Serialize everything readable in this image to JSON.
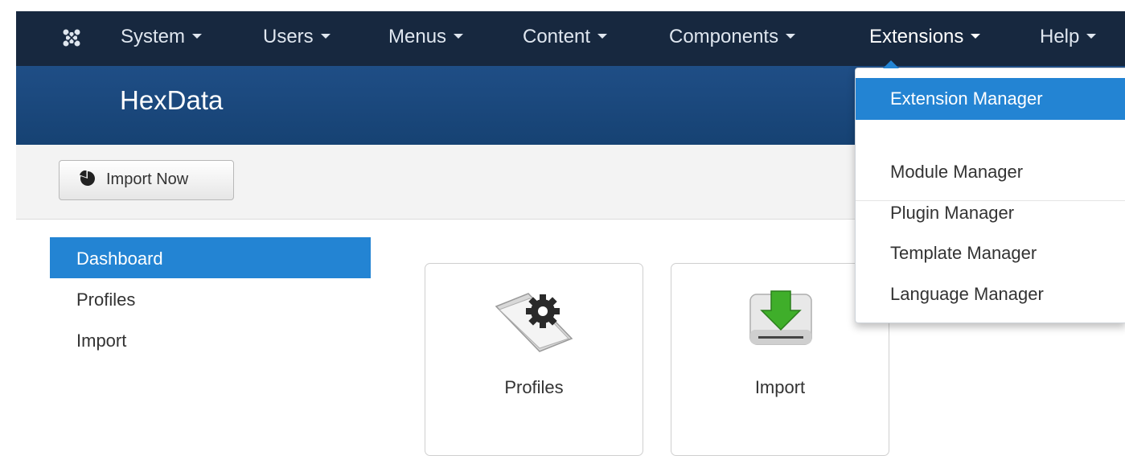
{
  "topbar": {
    "logo_icon": "joomla-logo-icon",
    "menus": [
      {
        "label": "System"
      },
      {
        "label": "Users"
      },
      {
        "label": "Menus"
      },
      {
        "label": "Content"
      },
      {
        "label": "Components"
      },
      {
        "label": "Extensions"
      },
      {
        "label": "Help"
      }
    ]
  },
  "header": {
    "title": "HexData"
  },
  "toolbar": {
    "import_button": "Import Now",
    "import_icon": "pie-chart-icon"
  },
  "sidebar": {
    "items": [
      {
        "label": "Dashboard",
        "active": true
      },
      {
        "label": "Profiles"
      },
      {
        "label": "Import"
      }
    ]
  },
  "cards": [
    {
      "label": "Profiles",
      "icon": "folder-gear-icon"
    },
    {
      "label": "Import",
      "icon": "download-drive-icon"
    }
  ],
  "dropdown": {
    "items": [
      {
        "label": "Extension Manager",
        "active": true
      },
      {
        "label": "Module Manager"
      },
      {
        "label": "Plugin Manager"
      },
      {
        "label": "Template Manager"
      },
      {
        "label": "Language Manager"
      }
    ]
  },
  "colors": {
    "topbar": "#17283f",
    "header": "#1c4a80",
    "accent": "#2384d3"
  }
}
